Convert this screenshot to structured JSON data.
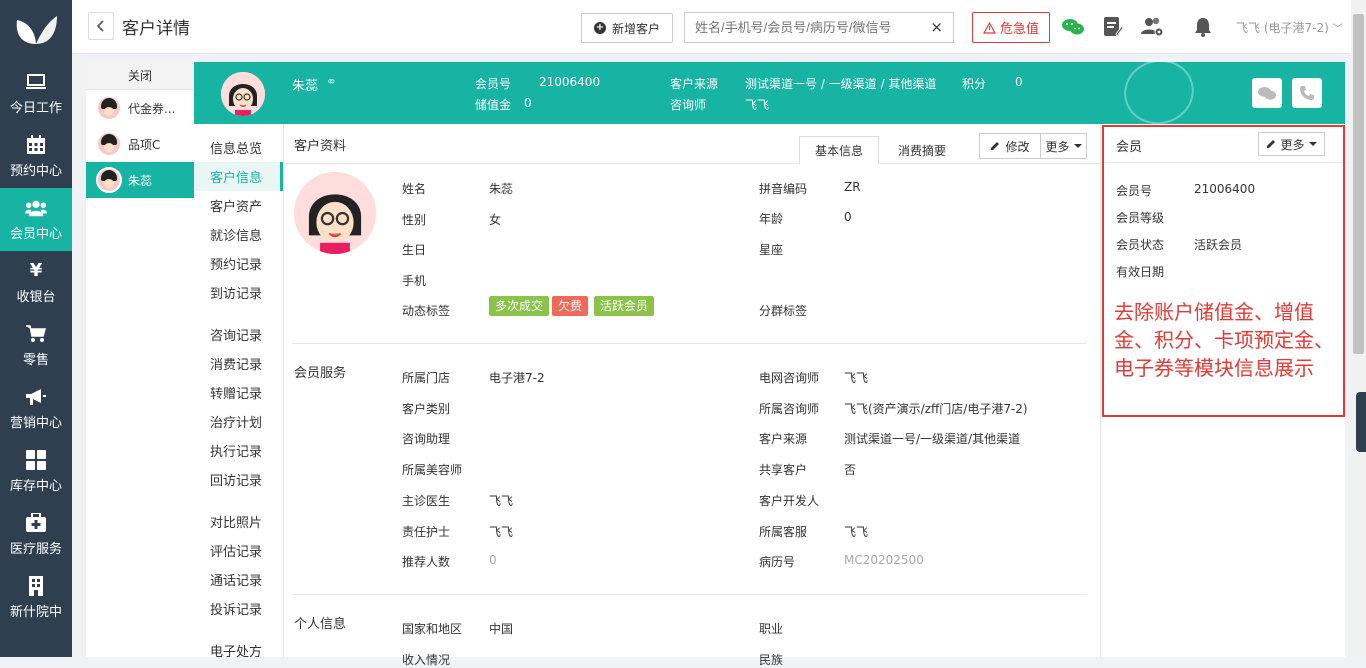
{
  "nav": {
    "items": [
      {
        "label": "今日工作",
        "icon": "monitor-icon"
      },
      {
        "label": "预约中心",
        "icon": "calendar-icon"
      },
      {
        "label": "会员中心",
        "icon": "members-icon"
      },
      {
        "label": "收银台",
        "icon": "yen-icon"
      },
      {
        "label": "零售",
        "icon": "cart-icon"
      },
      {
        "label": "营销中心",
        "icon": "megaphone-icon"
      },
      {
        "label": "库存中心",
        "icon": "grid-icon"
      },
      {
        "label": "医疗服务",
        "icon": "medkit-icon"
      },
      {
        "label": "新什院中",
        "icon": "building-icon"
      }
    ],
    "active_index": 2
  },
  "header": {
    "title": "客户详情",
    "new_customer": "新增客户",
    "search_placeholder": "姓名/手机号/会员号/病历号/微信号",
    "clear": "×",
    "danger": "危急值",
    "user": "飞飞 (电子港7-2)"
  },
  "customer_tabs": {
    "close": "关闭",
    "items": [
      "代金券...",
      "品项C",
      "朱蕊"
    ],
    "active_index": 2
  },
  "banner": {
    "name": "朱蕊",
    "member_no_label": "会员号",
    "member_no": "21006400",
    "stored_label": "储值金",
    "stored": "0",
    "source_label": "客户来源",
    "source": "测试渠道一号 / 一级渠道 / 其他渠道",
    "points_label": "积分",
    "points": "0",
    "consultant_label": "咨询师",
    "consultant": "飞飞"
  },
  "subnav": {
    "groups": [
      [
        "信息总览",
        "客户信息",
        "客户资产",
        "就诊信息",
        "预约记录",
        "到访记录"
      ],
      [
        "咨询记录",
        "消费记录",
        "转赠记录",
        "治疗计划",
        "执行记录",
        "回访记录"
      ],
      [
        "对比照片",
        "评估记录",
        "通话记录",
        "投诉记录"
      ],
      [
        "电子处方"
      ]
    ],
    "active": "客户信息"
  },
  "profile": {
    "section1": "客户资料",
    "tab_basic": "基本信息",
    "tab_consume": "消费摘要",
    "edit": "修改",
    "more": "更多",
    "left": [
      {
        "label": "姓名",
        "value": "朱蕊"
      },
      {
        "label": "性别",
        "value": "女"
      },
      {
        "label": "生日",
        "value": ""
      },
      {
        "label": "手机",
        "value": ""
      },
      {
        "label": "动态标签",
        "value": ""
      }
    ],
    "right": [
      {
        "label": "拼音编码",
        "value": "ZR"
      },
      {
        "label": "年龄",
        "value": "0"
      },
      {
        "label": "星座",
        "value": ""
      },
      {
        "label": "分群标签",
        "value": ""
      }
    ],
    "tags": [
      {
        "text": "多次成交",
        "color": "#8bc34a"
      },
      {
        "text": "欠费",
        "color": "#f06a5b"
      },
      {
        "text": "活跃会员",
        "color": "#8bc34a"
      }
    ],
    "section2": "会员服务",
    "svc_left": [
      {
        "label": "所属门店",
        "value": "电子港7-2"
      },
      {
        "label": "客户类别",
        "value": ""
      },
      {
        "label": "咨询助理",
        "value": ""
      },
      {
        "label": "所属美容师",
        "value": ""
      },
      {
        "label": "主诊医生",
        "value": "飞飞"
      },
      {
        "label": "责任护士",
        "value": "飞飞"
      },
      {
        "label": "推荐人数",
        "value": "0"
      }
    ],
    "svc_right": [
      {
        "label": "电网咨询师",
        "value": "飞飞"
      },
      {
        "label": "所属咨询师",
        "value": "飞飞(资产演示/zff门店/电子港7-2)"
      },
      {
        "label": "客户来源",
        "value": "测试渠道一号/一级渠道/其他渠道"
      },
      {
        "label": "共享客户",
        "value": "否"
      },
      {
        "label": "客户开发人",
        "value": ""
      },
      {
        "label": "所属客服",
        "value": "飞飞"
      },
      {
        "label": "病历号",
        "value": "MC20202500"
      }
    ],
    "section3": "个人信息",
    "pers_left": [
      {
        "label": "国家和地区",
        "value": "中国"
      },
      {
        "label": "收入情况",
        "value": ""
      }
    ],
    "pers_right": [
      {
        "label": "职业",
        "value": ""
      },
      {
        "label": "民族",
        "value": ""
      }
    ]
  },
  "member": {
    "title": "会员",
    "more": "更多",
    "rows": [
      {
        "label": "会员号",
        "value": "21006400"
      },
      {
        "label": "会员等级",
        "value": ""
      },
      {
        "label": "会员状态",
        "value": "活跃会员"
      },
      {
        "label": "有效日期",
        "value": ""
      }
    ],
    "annotation": "去除账户储值金、增值金、积分、卡项预定金、电子券等模块信息展示"
  },
  "colors": {
    "accent": "#17b3a3",
    "sidebar": "#2f3f4f",
    "danger": "#e53935",
    "wechat": "#2bb24c"
  }
}
